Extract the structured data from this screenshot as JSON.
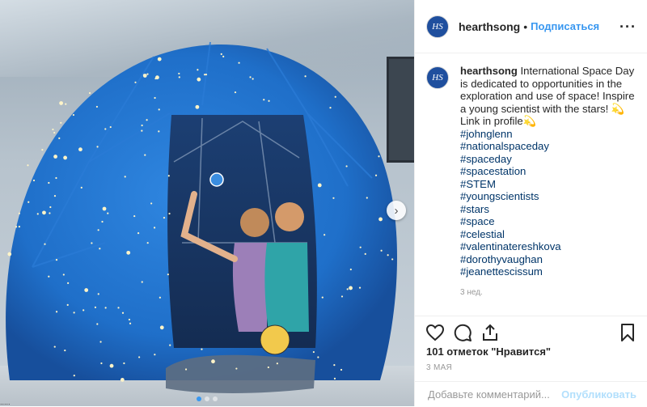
{
  "header": {
    "avatar_text": "HS",
    "username": "hearthsong",
    "separator": "•",
    "follow_label": "Подписаться",
    "more_label": "···"
  },
  "caption": {
    "username": "hearthsong",
    "text": "International Space Day is dedicated to opportunities in the exploration and use of space! Inspire a young scientist with the stars! 💫 Link in profile💫",
    "hashtags": [
      "#johnglenn",
      "#nationalspaceday",
      "#spaceday",
      "#spacestation",
      "#STEM",
      "#youngscientists",
      "#stars",
      "#space",
      "#celestial",
      "#valentinatereshkova",
      "#dorothyvaughan",
      "#jeanettescissum"
    ],
    "time": "3 нед."
  },
  "actions": {
    "likes": "101 отметок \"Нравится\"",
    "date": "3 МАЯ",
    "comment_placeholder": "Добавьте комментарий...",
    "publish_label": "Опубликовать"
  },
  "colors": {
    "link": "#3897f0",
    "hashtag": "#003569",
    "tent_blue": "#1e6fc8",
    "publish_disabled": "#b2dffc"
  },
  "icons": [
    "heart-icon",
    "comment-icon",
    "share-icon",
    "bookmark-icon",
    "chevron-right-icon",
    "more-icon"
  ],
  "photo": {
    "overlay_text": "....."
  }
}
